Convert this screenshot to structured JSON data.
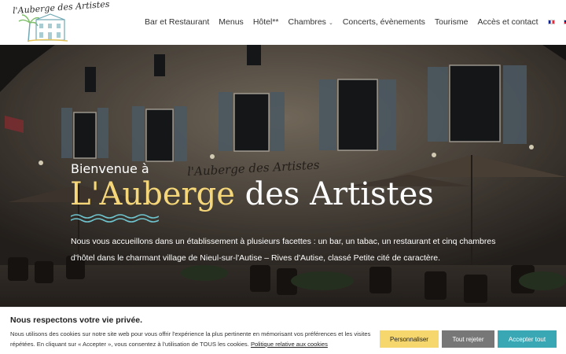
{
  "logo": {
    "text": "l'Auberge des Artistes"
  },
  "nav": {
    "items": [
      {
        "label": "Bar et Restaurant",
        "has_dropdown": false
      },
      {
        "label": "Menus",
        "has_dropdown": false
      },
      {
        "label": "Hôtel**",
        "has_dropdown": false
      },
      {
        "label": "Chambres",
        "has_dropdown": true
      },
      {
        "label": "Concerts, évènements",
        "has_dropdown": false
      },
      {
        "label": "Tourisme",
        "has_dropdown": false
      },
      {
        "label": "Accès et contact",
        "has_dropdown": false
      }
    ],
    "languages": [
      "fr",
      "en"
    ],
    "search_icon": "search-icon"
  },
  "hero": {
    "welcome": "Bienvenue à",
    "title_part1": "L'Auberge",
    "title_part2": "des Artistes",
    "intro": "Nous vous accueillons dans un établissement à plusieurs facettes : un bar, un tabac, un restaurant et cinq chambres d'hôtel dans le charmant village de Nieul-sur-l'Autise – Rives d'Autise, classé Petite cité de caractère.",
    "facade_sign": "l'Auberge des Artistes"
  },
  "cookie": {
    "title": "Nous respectons votre vie privée.",
    "text": "Nous utilisons des cookies sur notre site web pour vous offrir l'expérience la plus pertinente en mémorisant vos préférences et les visites répétées. En cliquant sur « Accepter », vous consentez à l'utilisation de TOUS les cookies.",
    "policy_link": "Politique relative aux cookies",
    "btn_customize": "Personnaliser",
    "btn_reject": "Tout rejeter",
    "btn_accept": "Accepter tout"
  },
  "colors": {
    "gold": "#f5d77a",
    "wave": "#6fc6d0",
    "customize": "#f5d76e",
    "reject": "#777777",
    "accept": "#3aa7b4"
  }
}
